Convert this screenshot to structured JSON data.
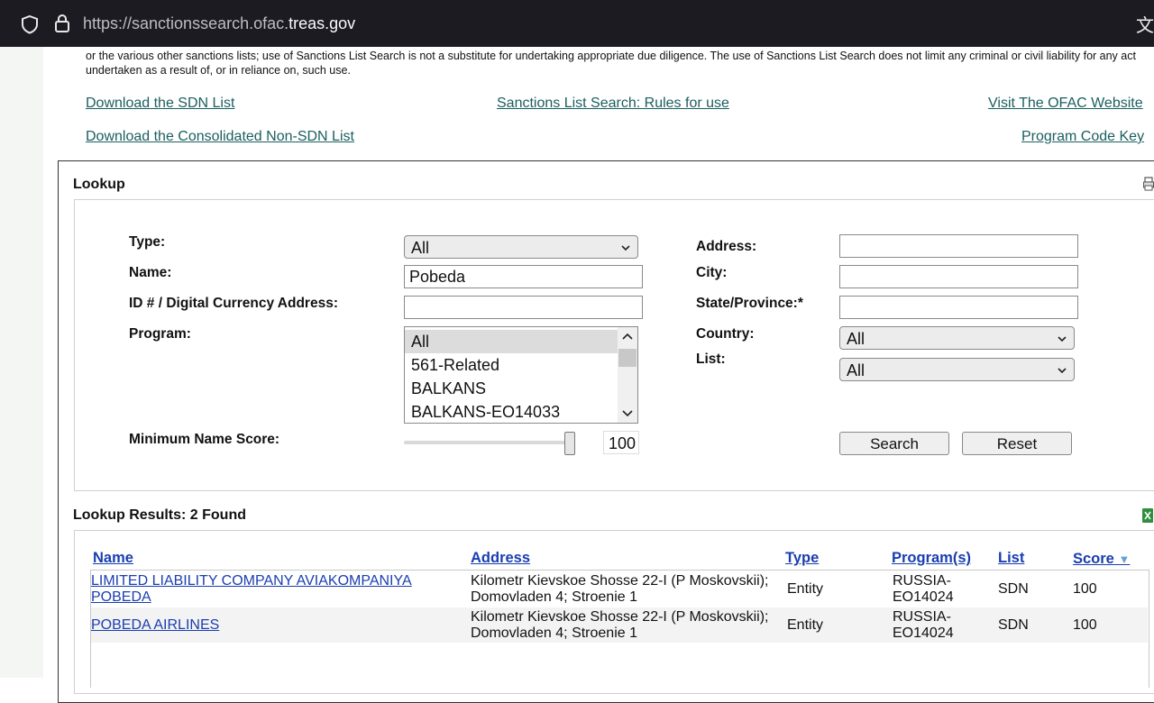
{
  "browser": {
    "url_prefix": "https://sanctionssearch.ofac.",
    "url_domain": "treas.gov",
    "translate_glyph": "文"
  },
  "disclaimer": "or the various other sanctions lists; use of Sanctions List Search is not a substitute for undertaking appropriate due diligence. The use of Sanctions List Search does not limit any criminal or civil liability for any act undertaken as a result of, or in reliance on, such use.",
  "links": {
    "download_sdn": "Download the SDN List",
    "rules": "Sanctions List Search: Rules for use",
    "visit_ofac": "Visit The OFAC Website",
    "download_consolidated": "Download the Consolidated Non-SDN List",
    "program_code_key": "Program Code Key"
  },
  "lookup": {
    "title": "Lookup",
    "labels": {
      "type": "Type:",
      "name": "Name:",
      "id": "ID # / Digital Currency Address:",
      "program": "Program:",
      "min_score": "Minimum Name Score:",
      "address": "Address:",
      "city": "City:",
      "state": "State/Province:*",
      "country": "Country:",
      "list": "List:"
    },
    "values": {
      "type": "All",
      "name": "Pobeda",
      "id": "",
      "address": "",
      "city": "",
      "state": "",
      "country": "All",
      "list": "All",
      "min_score": 100
    },
    "program_options": [
      "All",
      "561-Related",
      "BALKANS",
      "BALKANS-EO14033"
    ],
    "buttons": {
      "search": "Search",
      "reset": "Reset"
    }
  },
  "results": {
    "title": "Lookup Results: 2 Found",
    "headers": {
      "name": "Name",
      "address": "Address",
      "type": "Type",
      "programs": "Program(s)",
      "list": "List",
      "score": "Score",
      "sort_glyph": "▼"
    },
    "rows": [
      {
        "name_line1": "LIMITED LIABILITY COMPANY AVIAKOMPANIYA",
        "name_line2": "POBEDA",
        "address_line1": "Kilometr Kievskoe Shosse 22-I (P Moskovskii);",
        "address_line2": "Domovladen 4; Stroenie 1",
        "type": "Entity",
        "program_line1": "RUSSIA-",
        "program_line2": "EO14024",
        "list": "SDN",
        "score": "100"
      },
      {
        "name_line1": "POBEDA AIRLINES",
        "name_line2": "",
        "address_line1": "Kilometr Kievskoe Shosse 22-I (P Moskovskii);",
        "address_line2": "Domovladen 4; Stroenie 1",
        "type": "Entity",
        "program_line1": "RUSSIA-",
        "program_line2": "EO14024",
        "list": "SDN",
        "score": "100"
      }
    ]
  },
  "colors": {
    "link_teal": "#1b5e5e",
    "link_blue": "#1a3eb0",
    "browser_bg": "#1c1b22"
  }
}
